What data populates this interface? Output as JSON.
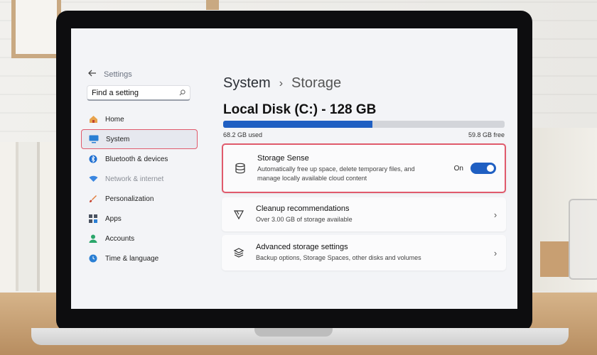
{
  "settings": {
    "app_title": "Settings",
    "search_placeholder": "Find a setting"
  },
  "sidebar": {
    "items": [
      {
        "label": "Home",
        "icon": "home-icon"
      },
      {
        "label": "System",
        "icon": "monitor-icon",
        "active": true
      },
      {
        "label": "Bluetooth & devices",
        "icon": "bluetooth-icon"
      },
      {
        "label": "Network & internet",
        "icon": "wifi-icon"
      },
      {
        "label": "Personalization",
        "icon": "brush-icon"
      },
      {
        "label": "Apps",
        "icon": "apps-icon"
      },
      {
        "label": "Accounts",
        "icon": "person-icon"
      },
      {
        "label": "Time & language",
        "icon": "globe-clock-icon"
      }
    ]
  },
  "breadcrumb": {
    "parent": "System",
    "separator": "›",
    "current": "Storage"
  },
  "disk": {
    "title": "Local Disk (C:) - 128 GB",
    "used_label": "68.2 GB used",
    "free_label": "59.8 GB free",
    "used_fraction": 0.53
  },
  "cards": {
    "storage_sense": {
      "title": "Storage Sense",
      "desc_line1": "Automatically free up space, delete temporary files, and",
      "desc_line2": "manage locally available cloud content",
      "toggle_label": "On"
    },
    "cleanup": {
      "title": "Cleanup recommendations",
      "desc": "Over 3.00 GB of storage available"
    },
    "advanced": {
      "title": "Advanced storage settings",
      "desc": "Backup options, Storage Spaces, other disks and volumes"
    }
  },
  "colors": {
    "accent": "#1f5fc2",
    "highlight_border": "#e05a6c"
  }
}
